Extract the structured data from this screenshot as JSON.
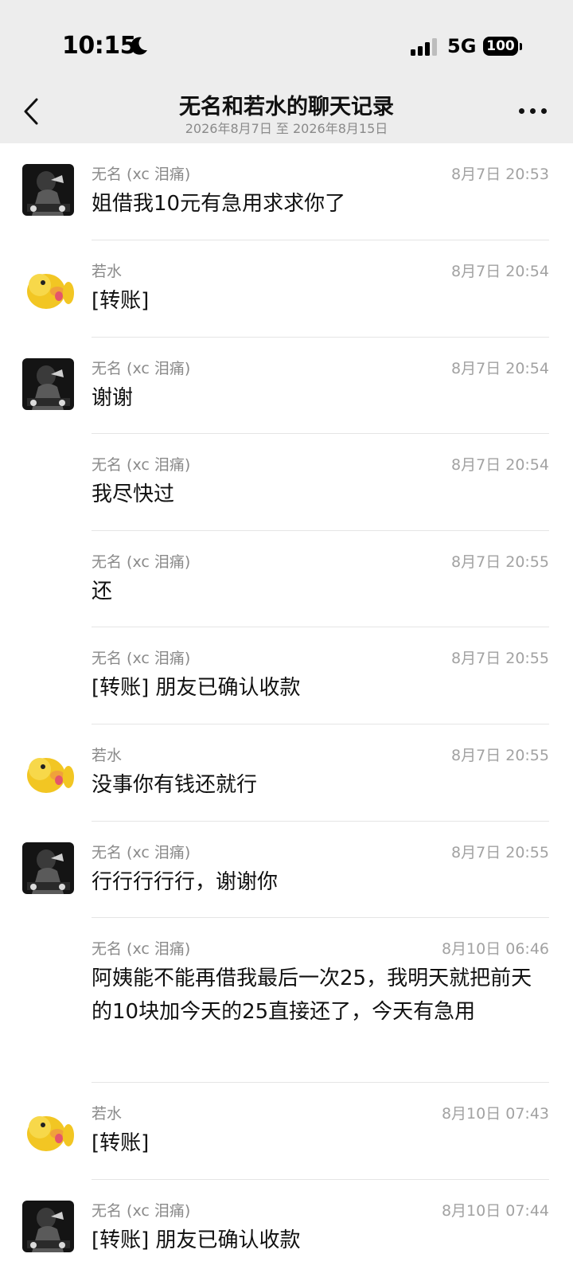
{
  "status_bar": {
    "time": "10:15",
    "network": "5G",
    "battery": "100",
    "icons": [
      "moon-icon",
      "signal-icon",
      "battery-icon"
    ]
  },
  "nav": {
    "title": "无名和若水的聊天记录",
    "subtitle": "2026年8月7日 至 2026年8月15日",
    "back_icon": "chevron-left-icon",
    "more_icon": "more-icon"
  },
  "messages": [
    {
      "sender": "无名 (xc 泪痛)",
      "time": "8月7日 20:53",
      "text": "姐借我10元有急用求求你了",
      "avatar": "dark-photo"
    },
    {
      "sender": "若水",
      "time": "8月7日 20:54",
      "text": "[转账]",
      "avatar": "yellow-duck"
    },
    {
      "sender": "无名 (xc 泪痛)",
      "time": "8月7日 20:54",
      "text": "谢谢",
      "avatar": "dark-photo"
    },
    {
      "sender": "无名 (xc 泪痛)",
      "time": "8月7日 20:54",
      "text": "我尽快过",
      "avatar": ""
    },
    {
      "sender": "无名 (xc 泪痛)",
      "time": "8月7日 20:55",
      "text": "还",
      "avatar": ""
    },
    {
      "sender": "无名 (xc 泪痛)",
      "time": "8月7日 20:55",
      "text": "[转账] 朋友已确认收款",
      "avatar": ""
    },
    {
      "sender": "若水",
      "time": "8月7日 20:55",
      "text": "没事你有钱还就行",
      "avatar": "yellow-duck"
    },
    {
      "sender": "无名 (xc 泪痛)",
      "time": "8月7日 20:55",
      "text": "行行行行行，谢谢你",
      "avatar": "dark-photo"
    },
    {
      "sender": "无名 (xc 泪痛)",
      "time": "8月10日 06:46",
      "text": "阿姨能不能再借我最后一次25，我明天就把前天的10块加今天的25直接还了，今天有急用",
      "avatar": ""
    },
    {
      "sender": "若水",
      "time": "8月10日 07:43",
      "text": "[转账]",
      "avatar": "yellow-duck"
    },
    {
      "sender": "无名 (xc 泪痛)",
      "time": "8月10日 07:44",
      "text": "[转账] 朋友已确认收款",
      "avatar": "dark-photo"
    }
  ]
}
